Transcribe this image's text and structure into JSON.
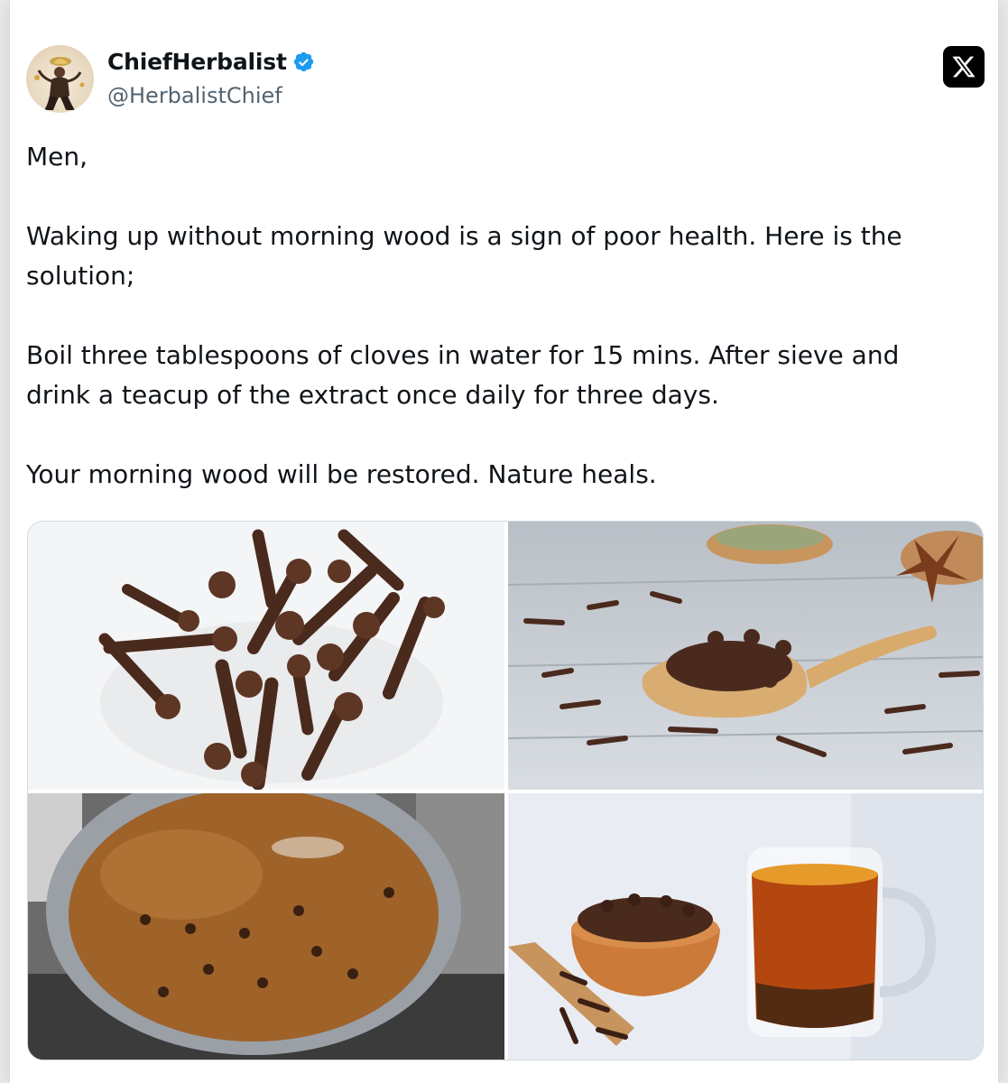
{
  "tweet": {
    "display_name": "ChiefHerbalist",
    "handle": "@HerbalistChief",
    "verified": true,
    "platform_logo": "x-logo-icon",
    "avatar_icon": "avatar-illustration",
    "paragraphs": [
      "Men,",
      "Waking up without morning wood is a sign of poor health. Here is the solution;",
      "Boil three tablespoons of cloves in water for 15 mins. After sieve and drink a teacup of the extract once daily for three days.",
      "Your morning wood will be restored. Nature heals."
    ],
    "media": [
      {
        "icon": "cloves-pile-photo"
      },
      {
        "icon": "cloves-wooden-spoon-photo"
      },
      {
        "icon": "boiling-clove-pot-photo"
      },
      {
        "icon": "clove-tea-cup-photo"
      }
    ]
  },
  "colors": {
    "text_primary": "#0f1419",
    "text_secondary": "#536471",
    "verified_blue": "#1d9bf0",
    "card_border": "#cfd9de"
  }
}
